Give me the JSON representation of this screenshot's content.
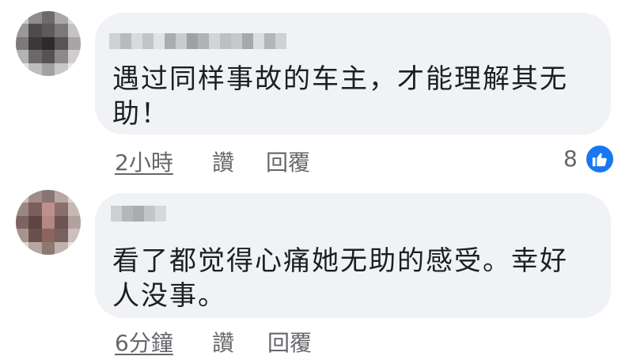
{
  "comments": [
    {
      "text": "遇过同样事故的车主，才能理解其无\n助！",
      "time": "2小時",
      "like_label": "讚",
      "reply_label": "回覆",
      "like_count": "8",
      "avatar_icon": "blurred-avatar",
      "name_icon": "blurred-name"
    },
    {
      "text": "看了都觉得心痛她无助的感受。幸好\n人没事。",
      "time": "6分鐘",
      "like_label": "讚",
      "reply_label": "回覆",
      "avatar_icon": "blurred-avatar",
      "name_icon": "blurred-name"
    }
  ],
  "colors": {
    "bubble": "#f0f2f5",
    "text": "#1c1e21",
    "meta": "#65676b",
    "like_blue": "#1877f2"
  }
}
